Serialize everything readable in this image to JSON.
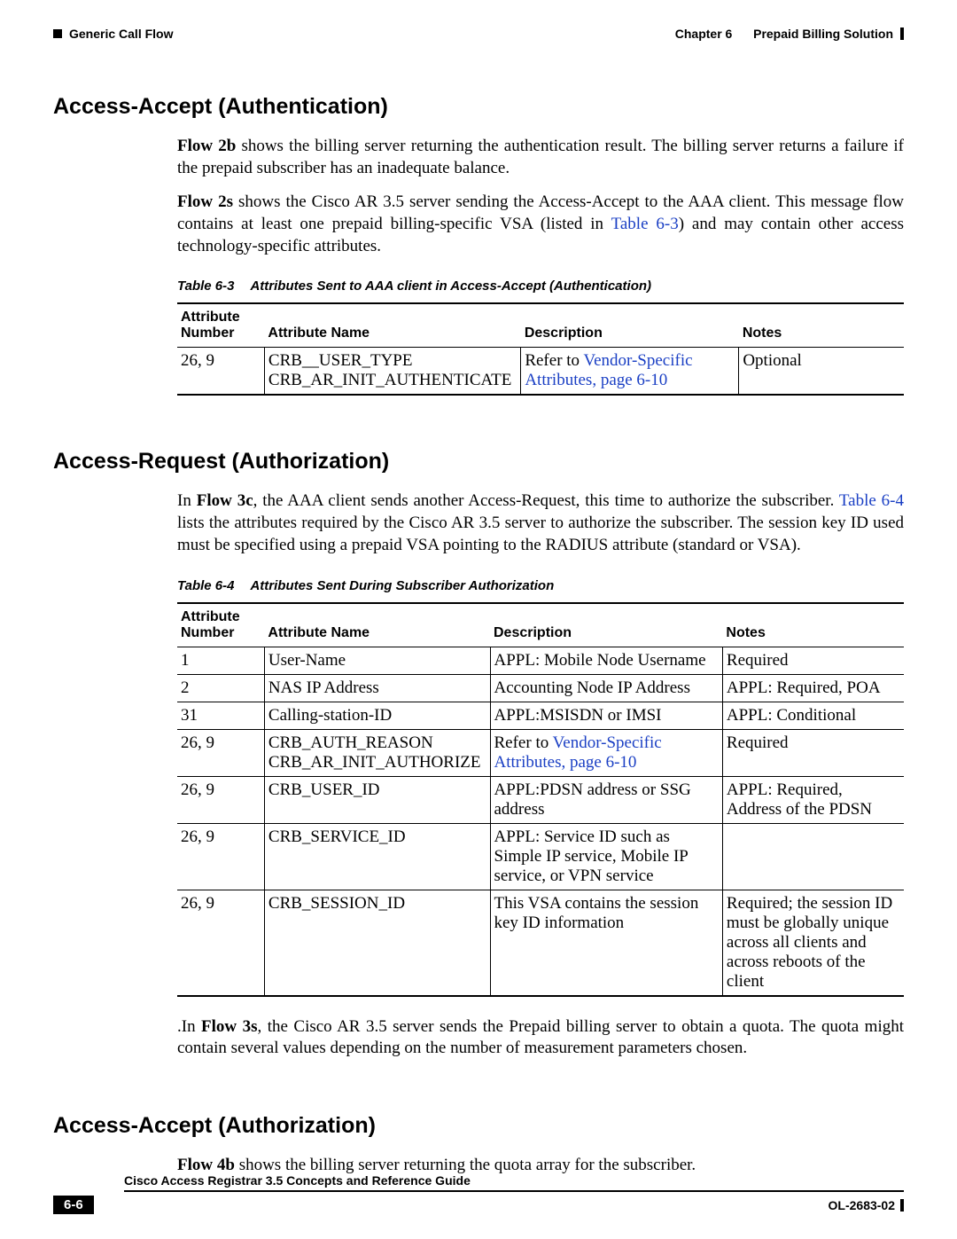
{
  "header": {
    "left": "Generic Call Flow",
    "chapter": "Chapter 6",
    "right": "Prepaid Billing Solution"
  },
  "sections": {
    "s1_title": "Access-Accept (Authentication)",
    "s1_p1_label": "Flow 2b",
    "s1_p1": " shows the billing server returning the authentication result. The billing server returns a failure if the prepaid subscriber has an inadequate balance.",
    "s1_p2_label": "Flow 2s",
    "s1_p2a": " shows the Cisco AR 3.5 server sending the Access-Accept to the AAA client. This message flow contains at least one prepaid billing-specific VSA (listed in ",
    "s1_p2_link": "Table 6-3",
    "s1_p2b": ") and may contain other access technology-specific attributes.",
    "s2_title": "Access-Request (Authorization)",
    "s2_p1a": "In ",
    "s2_p1_label": "Flow 3c",
    "s2_p1b": ", the AAA client sends another Access-Request, this time to authorize the subscriber. ",
    "s2_p1_link": "Table 6-4",
    "s2_p1c": " lists the attributes required by the Cisco AR 3.5 server to authorize the subscriber. The session key ID used must be specified using a prepaid VSA pointing to the RADIUS attribute (standard or VSA).",
    "s2_p2a": ".In ",
    "s2_p2_label": "Flow 3s",
    "s2_p2b": ", the Cisco AR 3.5 server sends the Prepaid billing server to obtain a quota. The quota might contain several values depending on the number of measurement parameters chosen.",
    "s3_title": "Access-Accept (Authorization)",
    "s3_p1_label": "Flow 4b",
    "s3_p1": " shows the billing server returning the quota array for the subscriber."
  },
  "table63": {
    "caption_num": "Table 6-3",
    "caption_title": "Attributes Sent to AAA client in Access-Accept (Authentication)",
    "headers": {
      "c1a": "Attribute",
      "c1b": "Number",
      "c2": "Attribute Name",
      "c3": "Description",
      "c4": "Notes"
    },
    "rows": [
      {
        "num": "26, 9",
        "name_a": "CRB__USER_TYPE",
        "name_b": "CRB_AR_INIT_AUTHENTICATE",
        "desc_a": "Refer to ",
        "desc_link": "Vendor-Specific Attributes, page 6-10",
        "notes": "Optional"
      }
    ]
  },
  "table64": {
    "caption_num": "Table 6-4",
    "caption_title": "Attributes Sent During Subscriber Authorization",
    "headers": {
      "c1a": "Attribute",
      "c1b": "Number",
      "c2": "Attribute Name",
      "c3": "Description",
      "c4": "Notes"
    },
    "rows": {
      "r0": {
        "num": "1",
        "name": "User-Name",
        "desc": "APPL: Mobile Node Username",
        "notes": "Required"
      },
      "r1": {
        "num": "2",
        "name": "NAS IP Address",
        "desc": "Accounting Node IP Address",
        "notes": "APPL: Required, POA"
      },
      "r2": {
        "num": "31",
        "name": "Calling-station-ID",
        "desc": "APPL:MSISDN or IMSI",
        "notes": "APPL: Conditional"
      },
      "r3": {
        "num": "26, 9",
        "name_a": "CRB_AUTH_REASON",
        "name_b": "CRB_AR_INIT_AUTHORIZE",
        "desc_a": "Refer to ",
        "desc_link": "Vendor-Specific Attributes, page 6-10",
        "notes": "Required"
      },
      "r4": {
        "num": "26, 9",
        "name": "CRB_USER_ID",
        "desc": "APPL:PDSN address or SSG address",
        "notes": "APPL: Required, Address of the PDSN"
      },
      "r5": {
        "num": "26, 9",
        "name": "CRB_SERVICE_ID",
        "desc": "APPL: Service ID such as Simple IP service, Mobile IP service, or VPN service",
        "notes": ""
      },
      "r6": {
        "num": "26, 9",
        "name": "CRB_SESSION_ID",
        "desc": "This VSA contains the session key ID information",
        "notes": "Required; the session ID must be globally unique across all clients and across reboots of the client"
      }
    }
  },
  "footer": {
    "title": "Cisco Access Registrar 3.5 Concepts and Reference Guide",
    "page": "6-6",
    "doc_id": "OL-2683-02"
  }
}
